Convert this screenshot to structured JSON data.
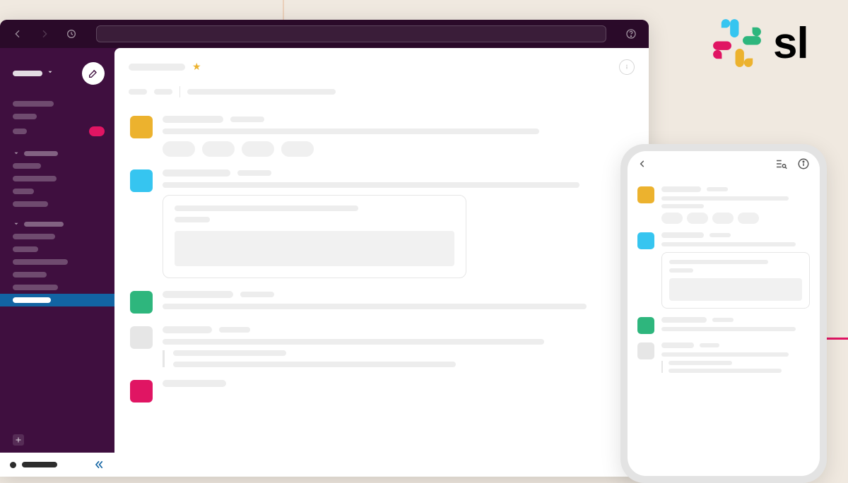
{
  "brand": {
    "wordmark": "sl"
  },
  "colors": {
    "sidebar": "#3f0f3f",
    "titlebar": "#2a0a29",
    "accent_blue": "#36c5f0",
    "accent_green": "#2eb67d",
    "accent_yellow": "#ecb22e",
    "accent_red": "#e01563",
    "selected": "#1264a3"
  },
  "icons": {
    "back": "back-arrow",
    "forward": "forward-arrow",
    "history": "clock",
    "help": "help-circle",
    "compose": "compose",
    "chevron_down": "chevron-down",
    "plus": "plus",
    "collapse": "double-chevron-left",
    "info": "info-circle",
    "star": "star",
    "search_list": "search-list"
  },
  "desktop": {
    "titlebar": {
      "search_placeholder": ""
    },
    "sidebar": {
      "workspace_name": "",
      "nav": [
        {
          "id": "nav-1"
        },
        {
          "id": "nav-2"
        },
        {
          "id": "nav-3",
          "badge": true
        }
      ],
      "section1_label": "",
      "channels": [
        {
          "id": "ch-1"
        },
        {
          "id": "ch-2"
        },
        {
          "id": "ch-3"
        },
        {
          "id": "ch-4"
        }
      ],
      "section2_label": "",
      "dms": [
        {
          "id": "dm-1"
        },
        {
          "id": "dm-2"
        },
        {
          "id": "dm-3"
        },
        {
          "id": "dm-4"
        },
        {
          "id": "dm-5"
        },
        {
          "id": "dm-6",
          "selected": true
        }
      ],
      "add_label": "",
      "connect_label": ""
    },
    "channel": {
      "name": "",
      "starred": true,
      "topic": "",
      "messages": [
        {
          "avatar": "yellow",
          "reactions": 4
        },
        {
          "avatar": "blue",
          "card": true
        },
        {
          "avatar": "green"
        },
        {
          "avatar": "grey",
          "thread": true
        },
        {
          "avatar": "pink"
        }
      ]
    }
  },
  "mobile": {
    "header": {
      "back": true
    },
    "messages": [
      {
        "avatar": "yellow",
        "reactions": 4
      },
      {
        "avatar": "blue",
        "card": true
      },
      {
        "avatar": "green"
      },
      {
        "avatar": "grey",
        "thread": true
      }
    ]
  }
}
